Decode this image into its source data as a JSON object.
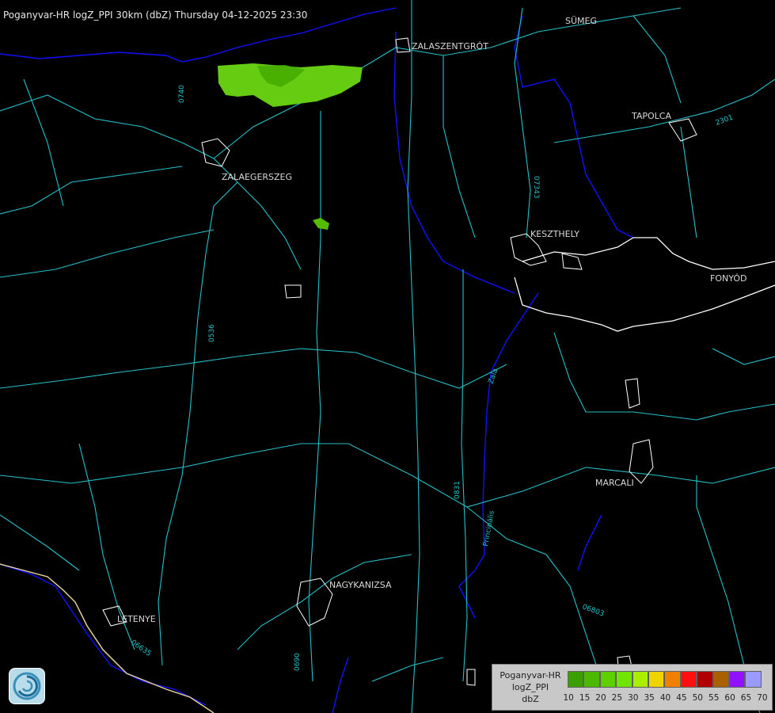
{
  "header": {
    "title": "Poganyvar-HR logZ_PPI 30km (dbZ) Thursday 04-12-2025 23:30"
  },
  "map": {
    "cities": [
      "SÜMEG",
      "ZALASZENTGRÓT",
      "TAPOLCA",
      "ZALAEGERSZEG",
      "KESZTHELY",
      "FONYÓD",
      "MARCALI",
      "NAGYKANIZSA",
      "LETENYE"
    ],
    "road_labels": [
      "0740",
      "07343",
      "0536",
      "0831",
      "06803",
      "0690",
      "06635",
      "2301"
    ],
    "river_labels": [
      "Zala",
      "Principális"
    ],
    "colors": {
      "background": "#000000",
      "roads": "#25c0c8",
      "rivers": "#1010ff",
      "lake_shore": "#ffffff",
      "border": "#f0d8a0",
      "echo_light": "#66cc11",
      "echo_dark": "#44aa00"
    }
  },
  "legend": {
    "line1": "Poganyvar-HR",
    "line2": "logZ_PPI",
    "line3": "dbZ",
    "scale": [
      10,
      15,
      20,
      25,
      30,
      35,
      40,
      45,
      50,
      55,
      60,
      65,
      70
    ],
    "colors": [
      "#3aa000",
      "#4cb800",
      "#5ed000",
      "#70e600",
      "#aaee00",
      "#f0d400",
      "#f08000",
      "#ff1010",
      "#b00000",
      "#a86000",
      "#9010ff",
      "#9a9aff"
    ]
  },
  "logo": {
    "icon": "radar-logo-icon"
  }
}
